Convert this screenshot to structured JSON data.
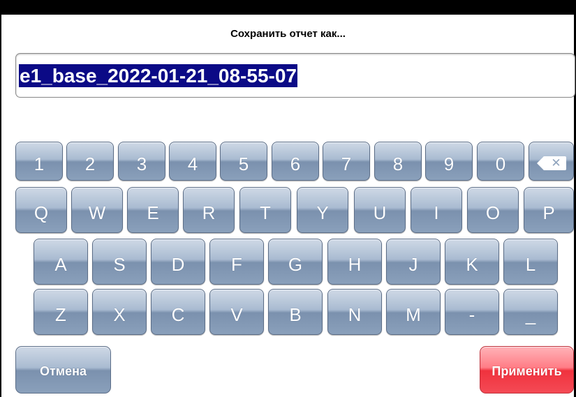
{
  "dialog": {
    "title": "Сохранить отчет как...",
    "filename_value": "e1_base_2022-01-21_08-55-07"
  },
  "keyboard": {
    "row1": [
      "1",
      "2",
      "3",
      "4",
      "5",
      "6",
      "7",
      "8",
      "9",
      "0"
    ],
    "row2": [
      "Q",
      "W",
      "E",
      "R",
      "T",
      "Y",
      "U",
      "I",
      "O",
      "P"
    ],
    "row3": [
      "A",
      "S",
      "D",
      "F",
      "G",
      "H",
      "J",
      "K",
      "L"
    ],
    "row4": [
      "Z",
      "X",
      "C",
      "V",
      "B",
      "N",
      "M",
      "-",
      "_"
    ],
    "backspace_icon": "backspace-icon",
    "backspace_glyph": "✕"
  },
  "buttons": {
    "cancel_label": "Отмена",
    "apply_label": "Применить"
  },
  "colors": {
    "key_blue": "#8aa0bb",
    "apply_red": "#f0323e",
    "selection": "#0b0a86"
  }
}
